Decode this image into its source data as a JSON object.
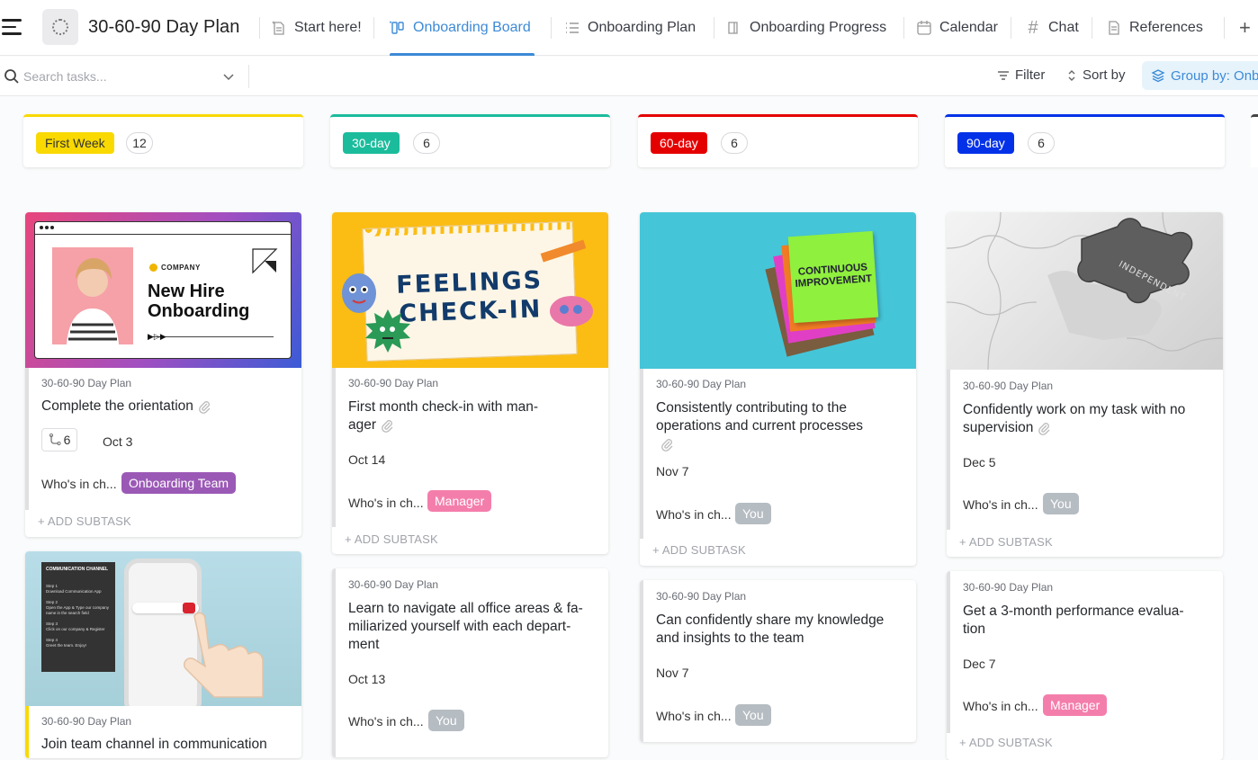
{
  "header": {
    "title": "30-60-90 Day Plan",
    "tabs": [
      {
        "label": "Start here!",
        "icon": "document-star-icon",
        "active": false
      },
      {
        "label": "Onboarding Board",
        "icon": "board-icon",
        "active": true
      },
      {
        "label": "Onboarding Plan",
        "icon": "list-icon",
        "active": false
      },
      {
        "label": "Onboarding Progress",
        "icon": "doc-icon",
        "active": false
      },
      {
        "label": "Calendar",
        "icon": "calendar-icon",
        "active": false
      },
      {
        "label": "Chat",
        "icon": "hashtag-icon",
        "active": false
      },
      {
        "label": "References",
        "icon": "document-icon",
        "active": false
      }
    ],
    "add_view": "+"
  },
  "toolbar": {
    "search_placeholder": "Search tasks...",
    "filter": "Filter",
    "sort": "Sort by",
    "group": "Group by: Onbo"
  },
  "colors": {
    "accent": "#3d8ad6",
    "first_week": "#f9d900",
    "day30": "#1bbc9c",
    "day60": "#e50000",
    "day90": "#0231e8",
    "onboarding_team": "#9b59b6",
    "manager": "#f47eab",
    "you": "#b5bcc2"
  },
  "columns": [
    {
      "label": "First Week",
      "count": "12"
    },
    {
      "label": "30-day",
      "count": "6"
    },
    {
      "label": "60-day",
      "count": "6"
    },
    {
      "label": "90-day",
      "count": "6"
    }
  ],
  "cards": {
    "c1": {
      "crumb": "30-60-90 Day Plan",
      "title": "Complete the orientation",
      "subtasks": "6",
      "date": "Oct 3",
      "who": "Who's in ch...",
      "assignee": "Onboarding Team",
      "add_subtask": "+ ADD SUBTASK",
      "cover": {
        "brand": "COMPANY",
        "line1": "New Hire",
        "line2": "Onboarding"
      }
    },
    "c2": {
      "crumb": "30-60-90 Day Plan",
      "title": "Join team channel in communication",
      "cover": {
        "heading": "COMMUNICATION CHANNEL",
        "steps": [
          "Step 1",
          "Download Communication App",
          "Step 2",
          "Open the App & Type our company name in the search field",
          "Step 3",
          "Click on our company & Register",
          "Step 4",
          "Greet the team. Enjoy!"
        ]
      }
    },
    "c3": {
      "crumb": "30-60-90 Day Plan",
      "title_lines": [
        "First month check-in with man-",
        "ager"
      ],
      "date": "Oct 14",
      "who": "Who's in ch...",
      "assignee": "Manager",
      "add_subtask": "+ ADD SUBTASK",
      "cover": {
        "line1": "FEELINGS",
        "line2": "CHECK-IN"
      }
    },
    "c4": {
      "crumb": "30-60-90 Day Plan",
      "title_lines": [
        "Learn to navigate all office areas & fa-",
        "miliarized yourself with each depart-",
        "ment"
      ],
      "date": "Oct 13",
      "who": "Who's in ch...",
      "assignee": "You"
    },
    "c5": {
      "crumb": "30-60-90 Day Plan",
      "title_lines": [
        "Consistently contributing to the",
        "operations and current processes"
      ],
      "date": "Nov 7",
      "who": "Who's in ch...",
      "assignee": "You",
      "add_subtask": "+ ADD SUBTASK",
      "cover": {
        "line1": "CONTINUOUS",
        "line2": "IMPROVEMENT"
      }
    },
    "c6": {
      "crumb": "30-60-90 Day Plan",
      "title_lines": [
        "Can confidently share my knowledge",
        "and insights to the team"
      ],
      "date": "Nov 7",
      "who": "Who's in ch...",
      "assignee": "You"
    },
    "c7": {
      "crumb": "30-60-90 Day Plan",
      "title_lines": [
        "Confidently work on my task with no",
        "supervision"
      ],
      "date": "Dec 5",
      "who": "Who's in ch...",
      "assignee": "You",
      "add_subtask": "+ ADD SUBTASK",
      "cover": {
        "word": "INDEPENDENT"
      }
    },
    "c8": {
      "crumb": "30-60-90 Day Plan",
      "title_lines": [
        "Get a 3-month performance evalua-",
        "tion"
      ],
      "date": "Dec 7",
      "who": "Who's in ch...",
      "assignee": "Manager",
      "add_subtask": "+ ADD SUBTASK"
    }
  }
}
